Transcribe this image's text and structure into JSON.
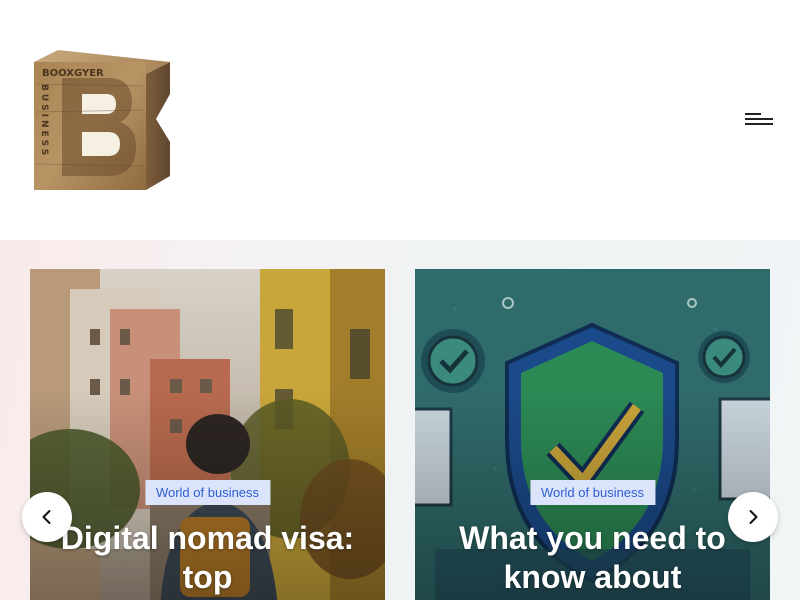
{
  "header": {
    "logo": {
      "alt": "Booxgyer Business logo",
      "text_top": "BOOXGYER",
      "text_side": "BUSINESS",
      "letter": "B"
    },
    "menu_icon": "hamburger-menu-icon"
  },
  "slider": {
    "prev_icon": "chevron-left-icon",
    "next_icon": "chevron-right-icon",
    "cards": [
      {
        "category": "World of business",
        "title": "Digital nomad visa: top",
        "image": "traveler-in-old-town-street"
      },
      {
        "category": "World of business",
        "title": "What you need to know about",
        "image": "security-shield-checkmark-illustration"
      }
    ]
  },
  "colors": {
    "badge_bg": "#dbe4fb",
    "badge_text": "#2f5fd0",
    "card2_bg": "#2f6b6a"
  }
}
